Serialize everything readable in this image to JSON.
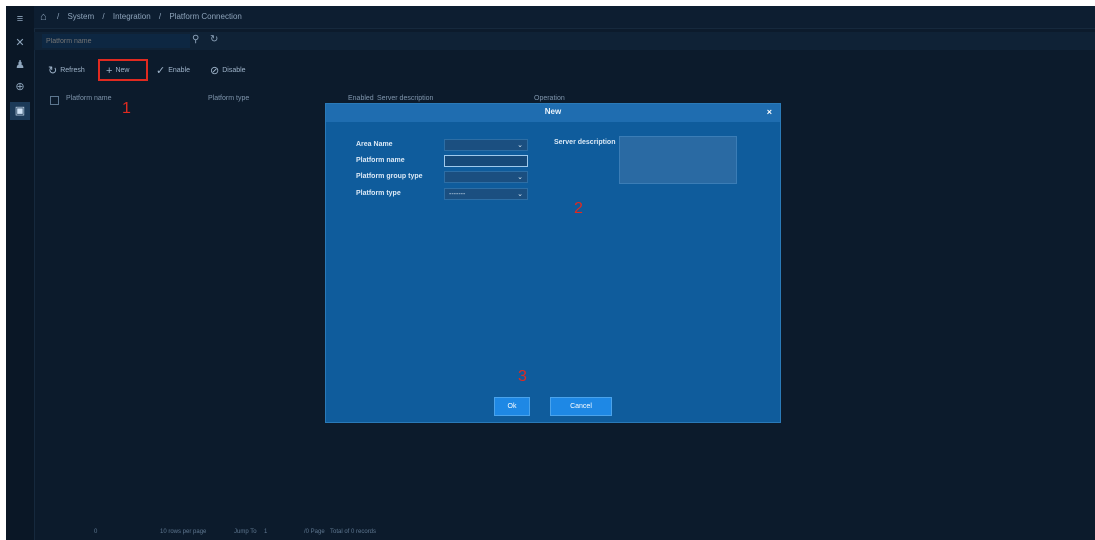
{
  "breadcrumb": {
    "home_icon": "home-icon",
    "items": [
      "System",
      "Integration",
      "Platform Connection"
    ],
    "separator": "/"
  },
  "sidebar": {
    "items": [
      {
        "icon": "menu-icon",
        "glyph": "≡"
      },
      {
        "icon": "tools-icon",
        "glyph": "✕"
      },
      {
        "icon": "user-icon",
        "glyph": "♟"
      },
      {
        "icon": "network-icon",
        "glyph": "⊕"
      },
      {
        "icon": "panel-icon",
        "glyph": "▣"
      }
    ]
  },
  "filter": {
    "placeholder": "Platform name",
    "search_icon": "⚲",
    "reset_icon": "↻"
  },
  "toolbar": {
    "refresh_label": "Refresh",
    "refresh_icon": "↻",
    "new_label": "New",
    "new_icon": "+",
    "enable_label": "Enable",
    "enable_icon": "✓",
    "disable_label": "Disable",
    "disable_icon": "⊘"
  },
  "table": {
    "columns": [
      "Platform name",
      "Platform type",
      "Enabled",
      "Server description",
      "Operation"
    ]
  },
  "footer": {
    "page": "0",
    "per_page": "10 rows per page",
    "jump_label": "Jump To",
    "jump_value": "1",
    "page_label": "/0 Page",
    "total": "Total of 0 records"
  },
  "dialog": {
    "title": "New",
    "close": "×",
    "fields": {
      "area_name": "Area Name",
      "platform_name": "Platform name",
      "platform_group_type": "Platform group type",
      "platform_type": "Platform type",
      "platform_type_value": "-------",
      "server_description": "Server description"
    },
    "ok_label": "Ok",
    "cancel_label": "Cancel"
  },
  "annotations": {
    "step1": "1",
    "step2": "2",
    "step3": "3"
  },
  "colors": {
    "accent": "#1e88e5",
    "dialog_bg": "#0f5c9c",
    "highlight": "#e02a20",
    "app_bg": "#0c1b2c"
  }
}
